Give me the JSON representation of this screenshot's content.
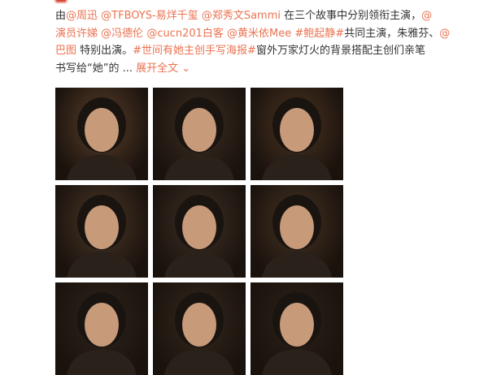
{
  "post": {
    "lines": [
      [
        {
          "t": "由",
          "k": "text"
        },
        {
          "t": "@周迅",
          "k": "link"
        },
        {
          "t": " ",
          "k": "text"
        },
        {
          "t": "@TFBOYS-易烊千玺",
          "k": "link"
        },
        {
          "t": " ",
          "k": "text"
        },
        {
          "t": "@郑秀文Sammi",
          "k": "link"
        },
        {
          "t": " 在三个故事中分别领衔主演，",
          "k": "text"
        },
        {
          "t": "@",
          "k": "link"
        }
      ],
      [
        {
          "t": "演员许娣",
          "k": "link"
        },
        {
          "t": " ",
          "k": "text"
        },
        {
          "t": "@冯德伦",
          "k": "link"
        },
        {
          "t": " ",
          "k": "text"
        },
        {
          "t": "@cucn201白客",
          "k": "link"
        },
        {
          "t": " ",
          "k": "text"
        },
        {
          "t": "@黄米依Mee",
          "k": "link"
        },
        {
          "t": " ",
          "k": "text"
        },
        {
          "t": "#鲍起静#",
          "k": "link"
        },
        {
          "t": "共同主演，朱雅芬、",
          "k": "text"
        },
        {
          "t": "@",
          "k": "link"
        }
      ],
      [
        {
          "t": "巴图",
          "k": "link"
        },
        {
          "t": " 特别出演。",
          "k": "text"
        },
        {
          "t": "#世间有她主创手写海报#",
          "k": "link"
        },
        {
          "t": "窗外万家灯火的背景搭配主创们亲笔",
          "k": "text"
        }
      ],
      [
        {
          "t": "书写给“她”的 ... ",
          "k": "text"
        },
        {
          "t": "展开全文",
          "k": "link"
        },
        {
          "t": " ⌄",
          "k": "link"
        }
      ]
    ]
  },
  "colors": {
    "link": "#eb7350",
    "text": "#333333"
  },
  "posters": [
    {
      "name": "poster-1",
      "tag": "",
      "handwriting": "",
      "tone": "#5a3f2a"
    },
    {
      "name": "poster-2",
      "tag": "",
      "handwriting": "",
      "tone": "#3b2f24"
    },
    {
      "name": "poster-3",
      "tag": "",
      "handwriting": "",
      "tone": "#4c3522"
    },
    {
      "name": "poster-4",
      "tag": "",
      "handwriting": "",
      "tone": "#4a3727"
    },
    {
      "name": "poster-5",
      "tag": "",
      "handwriting": "",
      "tone": "#3e3127"
    },
    {
      "name": "poster-6",
      "tag": "",
      "handwriting": "",
      "tone": "#463322"
    },
    {
      "name": "poster-7",
      "tag": "",
      "handwriting": "",
      "tone": "#2e241c"
    },
    {
      "name": "poster-8",
      "tag": "",
      "handwriting": "",
      "tone": "#34291f"
    },
    {
      "name": "poster-9",
      "tag": "",
      "handwriting": "",
      "tone": "#2c2119"
    }
  ]
}
